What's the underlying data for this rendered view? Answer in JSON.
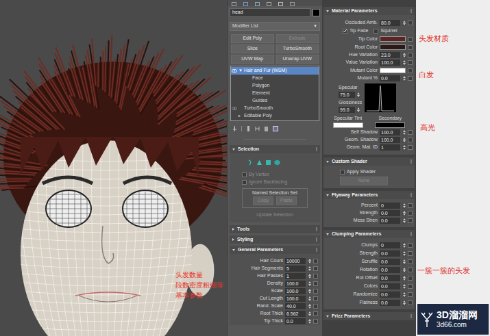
{
  "viewport": {
    "annotation": [
      "头发数量",
      "段数密度粗细等",
      "基本参数"
    ]
  },
  "modify_panel": {
    "object_name": "head",
    "object_color": "#000000",
    "modifier_list": {
      "label": "Modifier List",
      "arrow": "▼"
    },
    "modifier_buttons": [
      {
        "label": "Edit Poly",
        "disabled": false
      },
      {
        "label": "Extrude",
        "disabled": true
      },
      {
        "label": "Slice",
        "disabled": false
      },
      {
        "label": "TurboSmooth",
        "disabled": false
      },
      {
        "label": "UVW Map",
        "disabled": false
      },
      {
        "label": "Unwrap UVW",
        "disabled": false
      }
    ],
    "stack": [
      {
        "label": "Hair and Fur (WSM)",
        "sub": false,
        "selected": true,
        "visible": true,
        "arrow": "▼"
      },
      {
        "label": "Face",
        "sub": true,
        "selected": false,
        "visible": false
      },
      {
        "label": "Polygon",
        "sub": true,
        "selected": false,
        "visible": false
      },
      {
        "label": "Element",
        "sub": true,
        "selected": false,
        "visible": false
      },
      {
        "label": "Guides",
        "sub": true,
        "selected": false,
        "visible": false
      },
      {
        "label": "TurboSmooth",
        "sub": false,
        "selected": false,
        "visible": true
      },
      {
        "label": "Editable Poly",
        "sub": false,
        "selected": false,
        "visible": false,
        "arrow": "▸"
      }
    ],
    "selection": {
      "title": "Selection",
      "checks": [
        {
          "label": "By Vertex",
          "checked": false,
          "disabled": true
        },
        {
          "label": "Ignore Backfacing",
          "checked": false,
          "disabled": true
        }
      ],
      "group": {
        "label": "Named Selection Set",
        "buttons": [
          {
            "label": "Copy",
            "disabled": true
          },
          {
            "label": "Paste",
            "disabled": true
          }
        ]
      },
      "update": {
        "label": "Update Selection",
        "disabled": true
      }
    },
    "collapsed_rollouts": [
      "Tools",
      "Styling"
    ],
    "general": {
      "title": "General Parameters",
      "rows": [
        {
          "label": "Hair Count",
          "value": "10000"
        },
        {
          "label": "Hair Segments",
          "value": "5"
        },
        {
          "label": "Hair Passes",
          "value": "1"
        },
        {
          "label": "Density",
          "value": "100.0"
        },
        {
          "label": "Scale",
          "value": "100.0"
        },
        {
          "label": "Cut Length",
          "value": "100.0"
        },
        {
          "label": "Rand. Scale",
          "value": "40.0"
        },
        {
          "label": "Root Thick",
          "value": "6.562"
        },
        {
          "label": "Tip Thick",
          "value": "0.0"
        }
      ]
    }
  },
  "material": {
    "title": "Material Parameters",
    "rows": [
      {
        "kind": "spinner",
        "label": "Occluded Amb.",
        "value": "80.0"
      },
      {
        "kind": "checks",
        "items": [
          {
            "label": "Tip Fade",
            "checked": true
          },
          {
            "label": "Squirrel",
            "checked": false
          }
        ]
      },
      {
        "kind": "color",
        "label": "Tip Color",
        "color": "#5e2424"
      },
      {
        "kind": "color",
        "label": "Root Color",
        "color": "#2b1a16"
      },
      {
        "kind": "spinner",
        "label": "Hue Variation",
        "value": "23.0"
      },
      {
        "kind": "spinner",
        "label": "Value Variation",
        "value": "100.0"
      },
      {
        "kind": "color",
        "label": "Mutant Color",
        "color": "#ffffff"
      },
      {
        "kind": "spinner",
        "label": "Mutant %",
        "value": "0.0"
      },
      {
        "kind": "specular",
        "label": "Specular",
        "value": "75.0",
        "gloss_label": "Glossiness",
        "gloss_value": "99.0"
      },
      {
        "kind": "tints",
        "items": [
          {
            "label": "Specular Tint",
            "color": "#ffffff"
          },
          {
            "label": "Secondary",
            "color": "#000000"
          }
        ]
      },
      {
        "kind": "spinner",
        "label": "Self Shadow",
        "value": "100.0"
      },
      {
        "kind": "spinner",
        "label": "Geom. Shadow",
        "value": "100.0"
      },
      {
        "kind": "spinner",
        "label": "Geom. Mat. ID",
        "value": "1"
      }
    ]
  },
  "custom_shader": {
    "title": "Custom Shader",
    "check": {
      "label": "Apply Shader",
      "checked": false
    },
    "button": {
      "label": "None",
      "disabled": true
    }
  },
  "flyaway": {
    "title": "Flyaway Parameters",
    "rows": [
      {
        "label": "Percent",
        "value": "0"
      },
      {
        "label": "Strength",
        "value": "0.0"
      },
      {
        "label": "Mess Stren",
        "value": "0.0"
      }
    ]
  },
  "clumping": {
    "title": "Clumping Parameters",
    "rows": [
      {
        "label": "Clumps",
        "value": "0"
      },
      {
        "label": "Strength",
        "value": "0.0"
      },
      {
        "label": "Scruffle",
        "value": "0.0"
      },
      {
        "label": "Rotation",
        "value": "0.0"
      },
      {
        "label": "Rot Offset",
        "value": "0.0"
      },
      {
        "label": "Colors",
        "value": "0.0"
      },
      {
        "label": "Randomize",
        "value": "0.0"
      },
      {
        "label": "Flatness",
        "value": "0.0"
      }
    ]
  },
  "frizz": {
    "title": "Frizz Parameters"
  },
  "notes": [
    "头发材质",
    "白发",
    "高光",
    "一簇一簇的头发"
  ],
  "watermark": {
    "name": "3D溜溜网",
    "url": "3d66.com"
  }
}
